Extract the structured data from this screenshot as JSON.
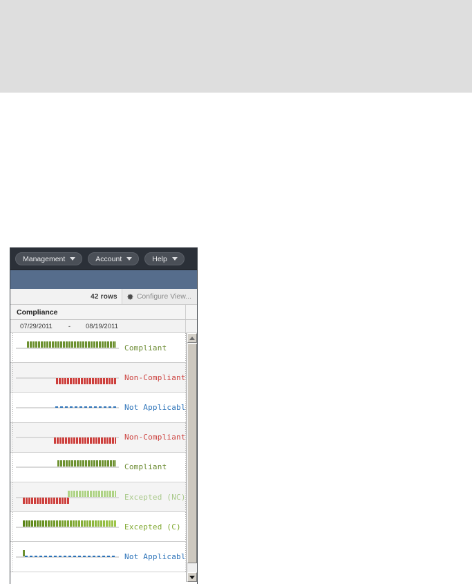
{
  "top_band": {
    "color": "#dedede"
  },
  "panel": {
    "menubar": {
      "items": [
        {
          "label": "Management",
          "icon": "chevron-down-icon"
        },
        {
          "label": "Account",
          "icon": "chevron-down-icon"
        },
        {
          "label": "Help",
          "icon": "chevron-down-icon"
        }
      ],
      "background": "#2b3038"
    },
    "accent_bar": {
      "color": "#566d8c"
    },
    "toolbar": {
      "rows_count": "42 rows",
      "configure_view_label": "Configure View...",
      "configure_view_icon": "gear-icon"
    },
    "column_header": {
      "label": "Compliance"
    },
    "date_range": {
      "start": "07/29/2011",
      "separator": "-",
      "end": "08/19/2011"
    },
    "scrollbar": {
      "up_icon": "scroll-up-arrow-icon",
      "down_icon": "scroll-down-arrow-icon"
    }
  },
  "chart_data": {
    "type": "bar",
    "title": "Compliance",
    "xlabel": "",
    "ylabel": "",
    "x_range": [
      "07/29/2011",
      "08/19/2011"
    ],
    "grid": false,
    "legend": "none",
    "categories": [
      "Compliant",
      "Non-Compliant",
      "Not Applicable",
      "Non-Compliant",
      "Compliant",
      "Excepted (NC)",
      "Excepted (C)",
      "Not Applicable"
    ],
    "rows": [
      {
        "status": "Compliant",
        "status_class": "s-compliant",
        "segments": [
          {
            "kind": "striped",
            "color": "#6d9130",
            "style": "striped-green",
            "side": "up",
            "start_pct": 11,
            "end_pct": 97
          }
        ],
        "dash": null,
        "shaded": false
      },
      {
        "status": "Non-Compliant",
        "status_class": "s-noncompliant",
        "segments": [
          {
            "kind": "striped",
            "color": "#cc3f3c",
            "style": "striped-red",
            "side": "down",
            "start_pct": 39,
            "end_pct": 97
          }
        ],
        "dash": null,
        "shaded": true
      },
      {
        "status": "Not Applicable",
        "status_class": "s-na",
        "segments": [],
        "dash": {
          "color": "#2b72b8",
          "start_pct": 38,
          "end_pct": 97
        },
        "shaded": false
      },
      {
        "status": "Non-Compliant",
        "status_class": "s-noncompliant",
        "segments": [
          {
            "kind": "striped",
            "color": "#cc3f3c",
            "style": "striped-red",
            "side": "down",
            "start_pct": 37,
            "end_pct": 97
          }
        ],
        "dash": null,
        "shaded": true
      },
      {
        "status": "Compliant",
        "status_class": "s-compliant",
        "segments": [
          {
            "kind": "striped",
            "color": "#6d9130",
            "style": "striped-green",
            "side": "up",
            "start_pct": 40,
            "end_pct": 97
          }
        ],
        "dash": null,
        "shaded": false
      },
      {
        "status": "Excepted (NC)",
        "status_class": "s-exnc",
        "segments": [
          {
            "kind": "striped",
            "color": "#cc3f3c",
            "style": "striped-red",
            "side": "down",
            "start_pct": 7,
            "end_pct": 52
          },
          {
            "kind": "striped",
            "color": "#aed285",
            "style": "striped-lgreen",
            "side": "up",
            "start_pct": 50,
            "end_pct": 97
          }
        ],
        "dash": null,
        "shaded": true
      },
      {
        "status": "Excepted (C)",
        "status_class": "s-exc",
        "segments": [
          {
            "kind": "gradient",
            "color": "#5b8418",
            "style": "striped-grad",
            "side": "up",
            "start_pct": 7,
            "end_pct": 97
          }
        ],
        "dash": null,
        "shaded": false
      },
      {
        "status": "Not Applicable",
        "status_class": "s-na",
        "segments": [
          {
            "kind": "striped",
            "color": "#6d9130",
            "style": "striped-green",
            "side": "up",
            "start_pct": 7,
            "end_pct": 9
          }
        ],
        "dash": {
          "color": "#2b72b8",
          "start_pct": 9,
          "end_pct": 97
        },
        "shaded": false
      }
    ]
  }
}
